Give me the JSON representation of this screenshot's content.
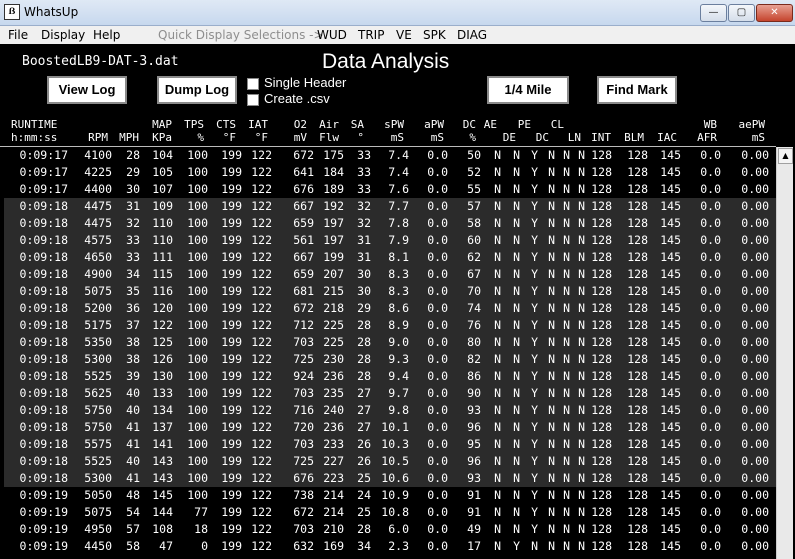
{
  "window": {
    "title": "WhatsUp",
    "app_icon": "tools-icon",
    "min": "—",
    "max": "▢",
    "close": "✕"
  },
  "menu": {
    "file": "File",
    "display": "Display",
    "help": "Help",
    "quick": "Quick Display Selections ->",
    "wud": "WUD",
    "trip": "TRIP",
    "ve": "VE",
    "spk": "SPK",
    "diag": "DIAG"
  },
  "dashboard": {
    "filename": "BoostedLB9-DAT-3.dat",
    "title": "Data Analysis",
    "view_log": "View Log",
    "dump_log": "Dump Log",
    "single_header": "Single Header",
    "create_csv": "Create .csv",
    "quarter_mile": "1/4 Mile",
    "find_mark": "Find Mark"
  },
  "columns": [
    {
      "h1": "RUNTIME",
      "h2": "h:mm:ss"
    },
    {
      "h1": "",
      "h2": "RPM"
    },
    {
      "h1": "",
      "h2": "MPH"
    },
    {
      "h1": "MAP",
      "h2": "KPa"
    },
    {
      "h1": "TPS",
      "h2": "%"
    },
    {
      "h1": "CTS",
      "h2": "°F"
    },
    {
      "h1": "IAT",
      "h2": "°F"
    },
    {
      "h1": "O2",
      "h2": "mV"
    },
    {
      "h1": "Air",
      "h2": "Flw"
    },
    {
      "h1": "SA",
      "h2": "°"
    },
    {
      "h1": "sPW",
      "h2": "mS"
    },
    {
      "h1": "aPW",
      "h2": "mS"
    },
    {
      "h1": "DC",
      "h2": "%"
    },
    {
      "h1": "AE",
      "h2": ""
    },
    {
      "h1": "",
      "h2": "DE"
    },
    {
      "h1": "PE",
      "h2": ""
    },
    {
      "h1": "",
      "h2": "DC"
    },
    {
      "h1": "CL",
      "h2": ""
    },
    {
      "h1": "",
      "h2": "LN"
    },
    {
      "h1": "",
      "h2": "INT"
    },
    {
      "h1": "",
      "h2": "BLM"
    },
    {
      "h1": "",
      "h2": "IAC"
    },
    {
      "h1": "WB",
      "h2": "AFR"
    },
    {
      "h1": "aePW",
      "h2": "mS"
    }
  ],
  "rows": [
    [
      "0:09:17",
      "4100",
      "28",
      "104",
      "100",
      "199",
      "122",
      "672",
      "175",
      "33",
      "7.4",
      "0.0",
      "50",
      "N",
      "N",
      "Y",
      "N",
      "N",
      "N",
      "128",
      "128",
      "145",
      "0.0",
      "0.00"
    ],
    [
      "0:09:17",
      "4225",
      "29",
      "105",
      "100",
      "199",
      "122",
      "641",
      "184",
      "33",
      "7.4",
      "0.0",
      "52",
      "N",
      "N",
      "Y",
      "N",
      "N",
      "N",
      "128",
      "128",
      "145",
      "0.0",
      "0.00"
    ],
    [
      "0:09:17",
      "4400",
      "30",
      "107",
      "100",
      "199",
      "122",
      "676",
      "189",
      "33",
      "7.6",
      "0.0",
      "55",
      "N",
      "N",
      "Y",
      "N",
      "N",
      "N",
      "128",
      "128",
      "145",
      "0.0",
      "0.00"
    ],
    [
      "0:09:18",
      "4475",
      "31",
      "109",
      "100",
      "199",
      "122",
      "667",
      "192",
      "32",
      "7.7",
      "0.0",
      "57",
      "N",
      "N",
      "Y",
      "N",
      "N",
      "N",
      "128",
      "128",
      "145",
      "0.0",
      "0.00"
    ],
    [
      "0:09:18",
      "4475",
      "32",
      "110",
      "100",
      "199",
      "122",
      "659",
      "197",
      "32",
      "7.8",
      "0.0",
      "58",
      "N",
      "N",
      "Y",
      "N",
      "N",
      "N",
      "128",
      "128",
      "145",
      "0.0",
      "0.00"
    ],
    [
      "0:09:18",
      "4575",
      "33",
      "110",
      "100",
      "199",
      "122",
      "561",
      "197",
      "31",
      "7.9",
      "0.0",
      "60",
      "N",
      "N",
      "Y",
      "N",
      "N",
      "N",
      "128",
      "128",
      "145",
      "0.0",
      "0.00"
    ],
    [
      "0:09:18",
      "4650",
      "33",
      "111",
      "100",
      "199",
      "122",
      "667",
      "199",
      "31",
      "8.1",
      "0.0",
      "62",
      "N",
      "N",
      "Y",
      "N",
      "N",
      "N",
      "128",
      "128",
      "145",
      "0.0",
      "0.00"
    ],
    [
      "0:09:18",
      "4900",
      "34",
      "115",
      "100",
      "199",
      "122",
      "659",
      "207",
      "30",
      "8.3",
      "0.0",
      "67",
      "N",
      "N",
      "Y",
      "N",
      "N",
      "N",
      "128",
      "128",
      "145",
      "0.0",
      "0.00"
    ],
    [
      "0:09:18",
      "5075",
      "35",
      "116",
      "100",
      "199",
      "122",
      "681",
      "215",
      "30",
      "8.3",
      "0.0",
      "70",
      "N",
      "N",
      "Y",
      "N",
      "N",
      "N",
      "128",
      "128",
      "145",
      "0.0",
      "0.00"
    ],
    [
      "0:09:18",
      "5200",
      "36",
      "120",
      "100",
      "199",
      "122",
      "672",
      "218",
      "29",
      "8.6",
      "0.0",
      "74",
      "N",
      "N",
      "Y",
      "N",
      "N",
      "N",
      "128",
      "128",
      "145",
      "0.0",
      "0.00"
    ],
    [
      "0:09:18",
      "5175",
      "37",
      "122",
      "100",
      "199",
      "122",
      "712",
      "225",
      "28",
      "8.9",
      "0.0",
      "76",
      "N",
      "N",
      "Y",
      "N",
      "N",
      "N",
      "128",
      "128",
      "145",
      "0.0",
      "0.00"
    ],
    [
      "0:09:18",
      "5350",
      "38",
      "125",
      "100",
      "199",
      "122",
      "703",
      "225",
      "28",
      "9.0",
      "0.0",
      "80",
      "N",
      "N",
      "Y",
      "N",
      "N",
      "N",
      "128",
      "128",
      "145",
      "0.0",
      "0.00"
    ],
    [
      "0:09:18",
      "5300",
      "38",
      "126",
      "100",
      "199",
      "122",
      "725",
      "230",
      "28",
      "9.3",
      "0.0",
      "82",
      "N",
      "N",
      "Y",
      "N",
      "N",
      "N",
      "128",
      "128",
      "145",
      "0.0",
      "0.00"
    ],
    [
      "0:09:18",
      "5525",
      "39",
      "130",
      "100",
      "199",
      "122",
      "924",
      "236",
      "28",
      "9.4",
      "0.0",
      "86",
      "N",
      "N",
      "Y",
      "N",
      "N",
      "N",
      "128",
      "128",
      "145",
      "0.0",
      "0.00"
    ],
    [
      "0:09:18",
      "5625",
      "40",
      "133",
      "100",
      "199",
      "122",
      "703",
      "235",
      "27",
      "9.7",
      "0.0",
      "90",
      "N",
      "N",
      "Y",
      "N",
      "N",
      "N",
      "128",
      "128",
      "145",
      "0.0",
      "0.00"
    ],
    [
      "0:09:18",
      "5750",
      "40",
      "134",
      "100",
      "199",
      "122",
      "716",
      "240",
      "27",
      "9.8",
      "0.0",
      "93",
      "N",
      "N",
      "Y",
      "N",
      "N",
      "N",
      "128",
      "128",
      "145",
      "0.0",
      "0.00"
    ],
    [
      "0:09:18",
      "5750",
      "41",
      "137",
      "100",
      "199",
      "122",
      "720",
      "236",
      "27",
      "10.1",
      "0.0",
      "96",
      "N",
      "N",
      "Y",
      "N",
      "N",
      "N",
      "128",
      "128",
      "145",
      "0.0",
      "0.00"
    ],
    [
      "0:09:18",
      "5575",
      "41",
      "141",
      "100",
      "199",
      "122",
      "703",
      "233",
      "26",
      "10.3",
      "0.0",
      "95",
      "N",
      "N",
      "Y",
      "N",
      "N",
      "N",
      "128",
      "128",
      "145",
      "0.0",
      "0.00"
    ],
    [
      "0:09:18",
      "5525",
      "40",
      "143",
      "100",
      "199",
      "122",
      "725",
      "227",
      "26",
      "10.5",
      "0.0",
      "96",
      "N",
      "N",
      "Y",
      "N",
      "N",
      "N",
      "128",
      "128",
      "145",
      "0.0",
      "0.00"
    ],
    [
      "0:09:18",
      "5300",
      "41",
      "143",
      "100",
      "199",
      "122",
      "676",
      "223",
      "25",
      "10.6",
      "0.0",
      "93",
      "N",
      "N",
      "Y",
      "N",
      "N",
      "N",
      "128",
      "128",
      "145",
      "0.0",
      "0.00"
    ],
    [
      "0:09:19",
      "5050",
      "48",
      "145",
      "100",
      "199",
      "122",
      "738",
      "214",
      "24",
      "10.9",
      "0.0",
      "91",
      "N",
      "N",
      "Y",
      "N",
      "N",
      "N",
      "128",
      "128",
      "145",
      "0.0",
      "0.00"
    ],
    [
      "0:09:19",
      "5075",
      "54",
      "144",
      "77",
      "199",
      "122",
      "672",
      "214",
      "25",
      "10.8",
      "0.0",
      "91",
      "N",
      "N",
      "Y",
      "N",
      "N",
      "N",
      "128",
      "128",
      "145",
      "0.0",
      "0.00"
    ],
    [
      "0:09:19",
      "4950",
      "57",
      "108",
      "18",
      "199",
      "122",
      "703",
      "210",
      "28",
      "6.0",
      "0.0",
      "49",
      "N",
      "N",
      "Y",
      "N",
      "N",
      "N",
      "128",
      "128",
      "145",
      "0.0",
      "0.00"
    ],
    [
      "0:09:19",
      "4450",
      "58",
      "47",
      "0",
      "199",
      "122",
      "632",
      "169",
      "34",
      "2.3",
      "0.0",
      "17",
      "N",
      "Y",
      "N",
      "N",
      "N",
      "N",
      "128",
      "128",
      "145",
      "0.0",
      "0.00"
    ]
  ],
  "row_shading": [
    "dark",
    "dark",
    "dark",
    "grey",
    "grey",
    "grey",
    "grey",
    "grey",
    "grey",
    "grey",
    "grey",
    "grey",
    "grey",
    "grey",
    "grey",
    "grey",
    "grey",
    "grey",
    "grey",
    "grey",
    "dark",
    "dark",
    "dark",
    "dark"
  ],
  "colors": {
    "background": "#000000",
    "grey_band": "#2b2b2b",
    "text": "#ffffff"
  },
  "scrollbar": {
    "up_arrow": "▲"
  }
}
